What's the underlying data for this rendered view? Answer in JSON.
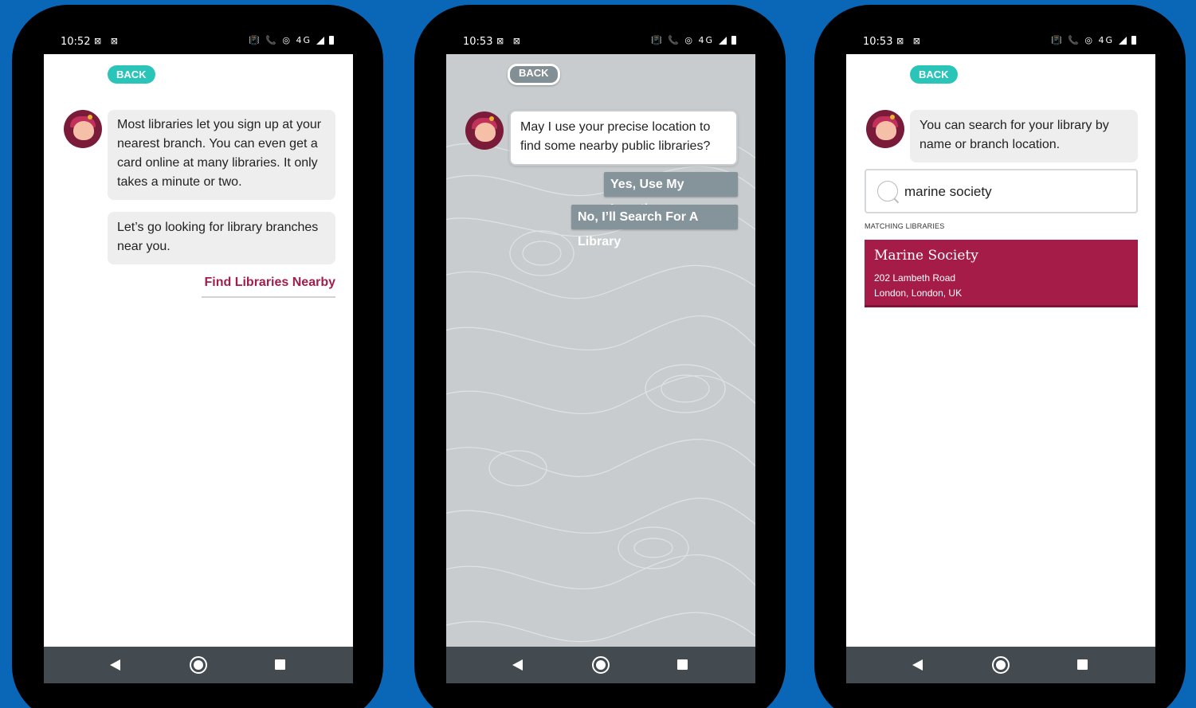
{
  "colors": {
    "background": "#0a66b7",
    "accent_teal": "#2bc4b9",
    "accent_burgundy": "#a51c48",
    "choice_grey": "#85939a",
    "navbar": "#434b50"
  },
  "phone1": {
    "status": {
      "time": "10:52",
      "left_icons": "⊠ ⊠",
      "right_icons": "📳 📞 ◎ 4G"
    },
    "back_label": "BACK",
    "messages": [
      "Most libraries let you sign up at your nearest branch. You can even get a card online at many libraries. It only takes a minute or two.",
      "Let’s go looking for library branches near you."
    ],
    "action_label": "Find Libraries Nearby"
  },
  "phone2": {
    "status": {
      "time": "10:53",
      "left_icons": "⊠ ⊠",
      "right_icons": "📳 📞 ◎ 4G"
    },
    "back_label": "BACK",
    "message": "May I use your precise location to find some nearby public libraries?",
    "choices": [
      "Yes, Use My Location",
      "No, I’ll Search For A Library"
    ]
  },
  "phone3": {
    "status": {
      "time": "10:53",
      "left_icons": "⊠ ⊠",
      "right_icons": "📳 📞 ◎ 4G"
    },
    "back_label": "BACK",
    "message": "You can search for your library by name or branch location.",
    "search_value": "marine society",
    "section_label": "MATCHING LIBRARIES",
    "result": {
      "name": "Marine Society",
      "address_line1": "202 Lambeth Road",
      "address_line2": "London, London, UK"
    }
  },
  "icons": [
    "avatar-icon",
    "search-icon",
    "nav-back-icon",
    "nav-home-icon",
    "nav-recent-icon",
    "battery-icon",
    "signal-icon"
  ]
}
